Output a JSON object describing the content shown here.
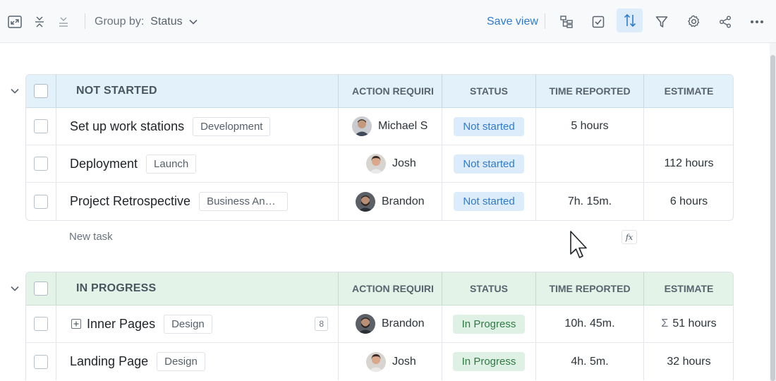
{
  "toolbar": {
    "group_by_label": "Group by:",
    "group_by_value": "Status",
    "save_view_label": "Save view",
    "icons": [
      "fit-screen-icon",
      "collapse-rows-icon",
      "collapse-all-icon",
      "hierarchy-icon",
      "checkbox-icon",
      "sort-icon",
      "filter-icon",
      "gear-icon",
      "share-icon",
      "more-icon"
    ],
    "accent_color": "#2f7bd0"
  },
  "columns": {
    "action_required": "ACTION REQUIRI",
    "status": "STATUS",
    "time_reported": "TIME REPORTED",
    "estimate": "ESTIMATE"
  },
  "groups": {
    "not_started": {
      "title": "NOT STARTED",
      "header_color": "#e3f1fb",
      "rows": [
        {
          "name": "Set up work stations",
          "tag": "Development",
          "assignee": "Michael S",
          "status": "Not started",
          "time_reported": "5 hours",
          "estimate": ""
        },
        {
          "name": "Deployment",
          "tag": "Launch",
          "assignee": "Josh",
          "status": "Not started",
          "time_reported": "",
          "estimate": "112 hours"
        },
        {
          "name": "Project Retrospective",
          "tag": "Business Anal...",
          "assignee": "Brandon",
          "status": "Not started",
          "time_reported": "7h. 15m.",
          "estimate": "6 hours"
        }
      ],
      "new_task_label": "New task",
      "formula_label": "fx"
    },
    "in_progress": {
      "title": "IN PROGRESS",
      "header_color": "#e3f3e8",
      "rows": [
        {
          "name": "Inner Pages",
          "tag": "Design",
          "subtask_count": "8",
          "assignee": "Brandon",
          "status": "In Progress",
          "time_reported": "10h. 45m.",
          "estimate_symbol": "Σ",
          "estimate": "51 hours"
        },
        {
          "name": "Landing Page",
          "tag": "Design",
          "assignee": "Josh",
          "status": "In Progress",
          "time_reported": "4h. 5m.",
          "estimate": "32 hours"
        }
      ]
    }
  }
}
